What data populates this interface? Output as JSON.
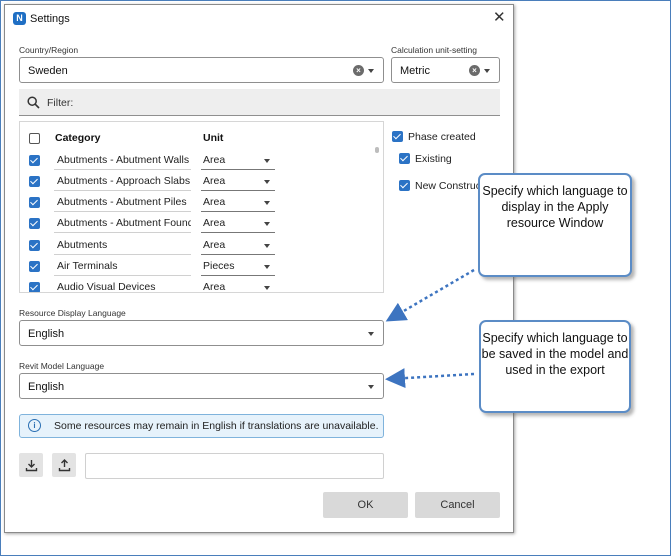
{
  "dialog": {
    "title": "Settings",
    "app_icon_letter": "N",
    "close_glyph": "✕"
  },
  "country": {
    "label": "Country/Region",
    "value": "Sweden"
  },
  "unit_setting": {
    "label": "Calculation unit-setting",
    "value": "Metric"
  },
  "filter": {
    "label": "Filter:"
  },
  "table": {
    "headers": {
      "category": "Category",
      "unit": "Unit"
    },
    "rows": [
      {
        "category": "Abutments - Abutment Walls",
        "unit": "Area",
        "checked": true
      },
      {
        "category": "Abutments - Approach Slabs",
        "unit": "Area",
        "checked": true
      },
      {
        "category": "Abutments - Abutment Piles",
        "unit": "Area",
        "checked": true
      },
      {
        "category": "Abutments - Abutment Foundations",
        "unit": "Area",
        "checked": true
      },
      {
        "category": "Abutments",
        "unit": "Area",
        "checked": true
      },
      {
        "category": "Air Terminals",
        "unit": "Pieces",
        "checked": true
      },
      {
        "category": "Audio Visual Devices",
        "unit": "Area",
        "checked": true
      }
    ]
  },
  "phases": {
    "phase_created": "Phase created",
    "existing": "Existing",
    "new_construction": "New Construction"
  },
  "resource_language": {
    "label": "Resource Display Language",
    "value": "English"
  },
  "revit_language": {
    "label": "Revit Model Language",
    "value": "English"
  },
  "info": {
    "icon": "info-icon",
    "glyph": "i",
    "text": "Some resources may remain in English if translations are unavailable."
  },
  "buttons": {
    "ok": "OK",
    "cancel": "Cancel"
  },
  "callouts": {
    "display_language": "Specify which language to display in the Apply resource Window",
    "model_language": "Specify which language to be saved in the model and used in the export"
  },
  "colors": {
    "accent": "#2b73c5",
    "callout_border": "#5b8cc6",
    "arrow": "#3d74c0",
    "info_bg": "#e6f2fb"
  }
}
